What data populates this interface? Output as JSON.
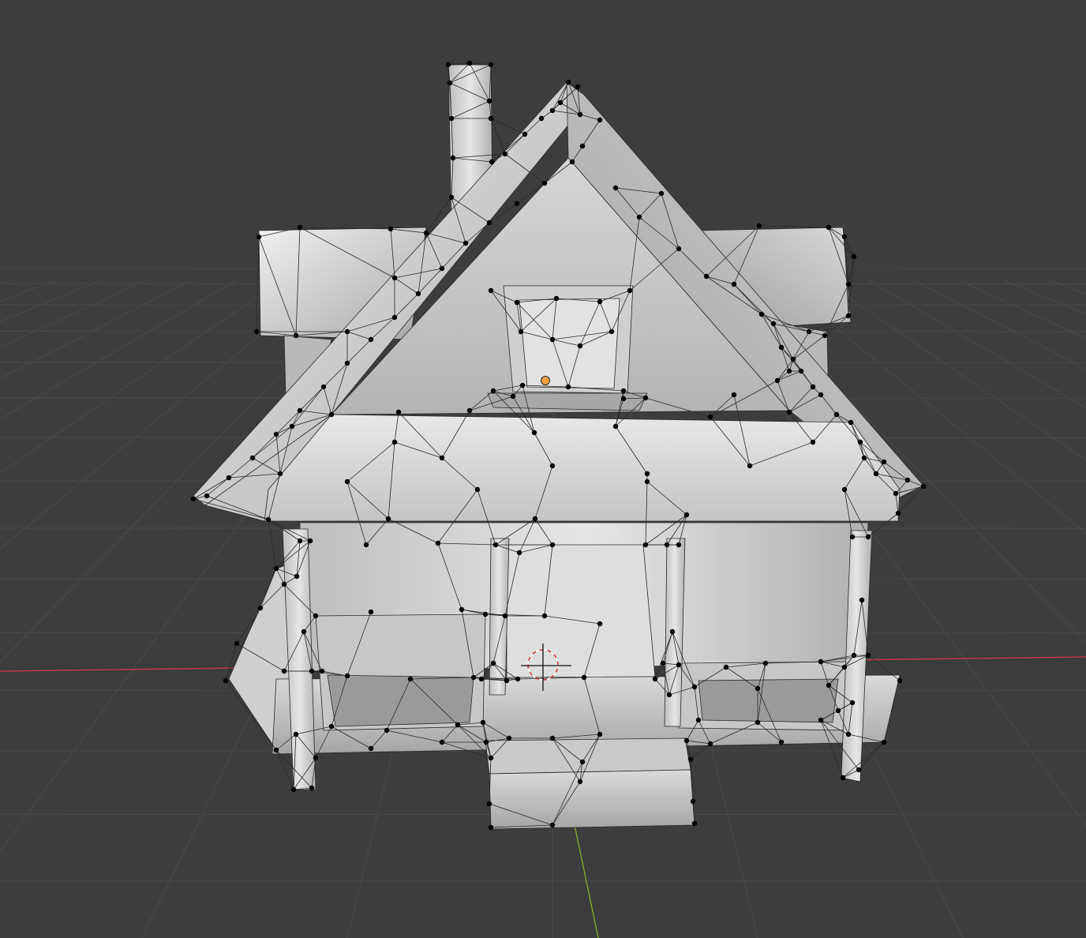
{
  "app": "3D viewport",
  "viewport": {
    "background": "#3d3d3d",
    "grid_color": "#4a4a4a",
    "x_axis_color": "#c0394b",
    "y_axis_color": "#7aa32b",
    "mesh_fill_light": "#e0e0e0",
    "mesh_fill_dark": "#9a9a9a",
    "wire_color": "#2a2a2a",
    "vertex_color": "#000000",
    "origin_color": "#f0a040",
    "cursor_color": "#d03030"
  },
  "mesh": {
    "name": "house",
    "mode": "edit",
    "shading": "solid"
  },
  "icons": {
    "cursor": "3d-cursor-icon",
    "origin": "object-origin-icon"
  }
}
